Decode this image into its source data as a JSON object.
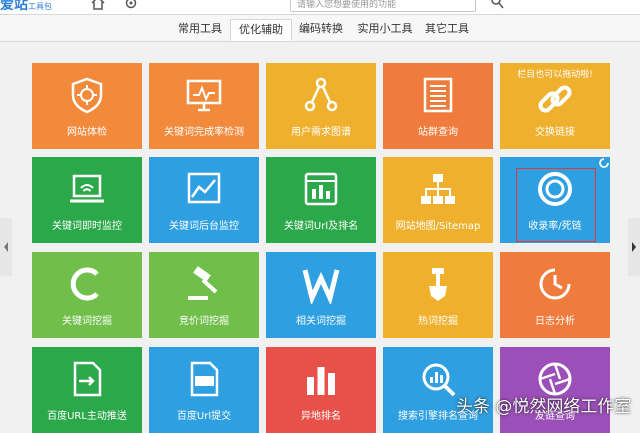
{
  "header": {
    "logo_main": "爱站",
    "logo_sub": "工具包",
    "search_placeholder": "请输入您想要使用的功能"
  },
  "tabs": [
    {
      "label": "常用工具",
      "active": false
    },
    {
      "label": "优化辅助",
      "active": true
    },
    {
      "label": "编码转换",
      "active": false
    },
    {
      "label": "实用小工具",
      "active": false
    },
    {
      "label": "其它工具",
      "active": false
    }
  ],
  "tiles": [
    {
      "label": "网站体检",
      "color": "#f28a3b",
      "icon": "shield-icon"
    },
    {
      "label": "关键词完成率检测",
      "color": "#f28a3b",
      "icon": "monitor-chart-icon"
    },
    {
      "label": "用户需求图谱",
      "color": "#efb02e",
      "icon": "graph-nodes-icon"
    },
    {
      "label": "站群查询",
      "color": "#ef7b3c",
      "icon": "list-document-icon"
    },
    {
      "label": "交换链接",
      "color": "#efb02e",
      "icon": "chain-link-icon",
      "note": "栏目也可以拖动啦!"
    },
    {
      "label": "关键词即时监控",
      "color": "#2ba84a",
      "icon": "laptop-icon"
    },
    {
      "label": "关键词后台监控",
      "color": "#2e9fe0",
      "icon": "chart-window-icon"
    },
    {
      "label": "关键词Url及排名",
      "color": "#2ba84a",
      "icon": "bar-chart-icon"
    },
    {
      "label": "网站地图/Sitemap",
      "color": "#efb02e",
      "icon": "sitemap-icon"
    },
    {
      "label": "收录率/死链",
      "color": "#2e9fe0",
      "icon": "ring-icon"
    },
    {
      "label": "关键词挖掘",
      "color": "#6fbf4a",
      "icon": "letter-c-icon"
    },
    {
      "label": "竞价词挖掘",
      "color": "#6fbf4a",
      "icon": "gavel-icon"
    },
    {
      "label": "相关词挖掘",
      "color": "#2e9fe0",
      "icon": "letter-w-icon"
    },
    {
      "label": "热词挖掘",
      "color": "#f0b02c",
      "icon": "shovel-icon"
    },
    {
      "label": "日志分析",
      "color": "#ef7b3c",
      "icon": "clock-icon"
    },
    {
      "label": "百度URL主动推送",
      "color": "#2ba84a",
      "icon": "push-document-icon"
    },
    {
      "label": "百度Url提交",
      "color": "#2e9fe0",
      "icon": "url-document-icon"
    },
    {
      "label": "异地排名",
      "color": "#e8514a",
      "icon": "columns-chart-icon"
    },
    {
      "label": "搜索引擎排名查询",
      "color": "#2e9fe0",
      "icon": "magnifier-chart-icon"
    },
    {
      "label": "友链查询",
      "color": "#9c4fb8",
      "icon": "aperture-icon"
    }
  ],
  "watermark": "头条 @悦然网络工作室"
}
